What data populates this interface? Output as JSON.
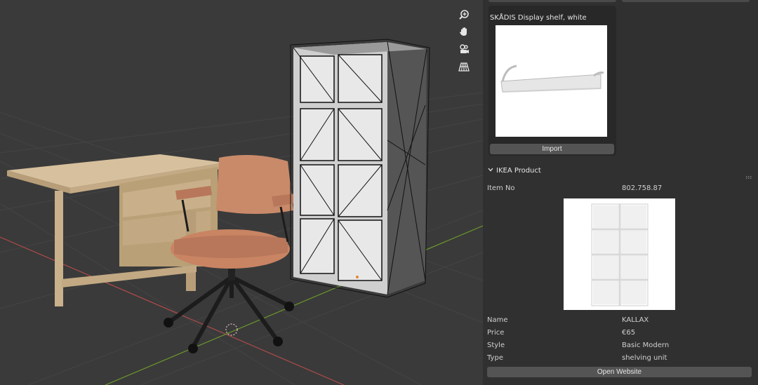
{
  "viewport": {
    "nav_icons": [
      "zoom-icon",
      "pan-hand-icon",
      "camera-view-icon",
      "perspective-grid-icon"
    ],
    "colors": {
      "background": "#3a3a3a",
      "axis_x": "#b04a4a",
      "axis_y": "#6c9a2a"
    }
  },
  "search_result": {
    "title": "SKÅDIS Display shelf, white",
    "import_label": "Import"
  },
  "product": {
    "section_title": "IKEA Product",
    "fields": [
      {
        "label": "Item No",
        "value": "802.758.87"
      },
      {
        "label": "Name",
        "value": "KALLAX"
      },
      {
        "label": "Price",
        "value": "€65"
      },
      {
        "label": "Style",
        "value": "Basic Modern"
      },
      {
        "label": "Type",
        "value": "shelving unit"
      }
    ],
    "open_label": "Open Website"
  }
}
